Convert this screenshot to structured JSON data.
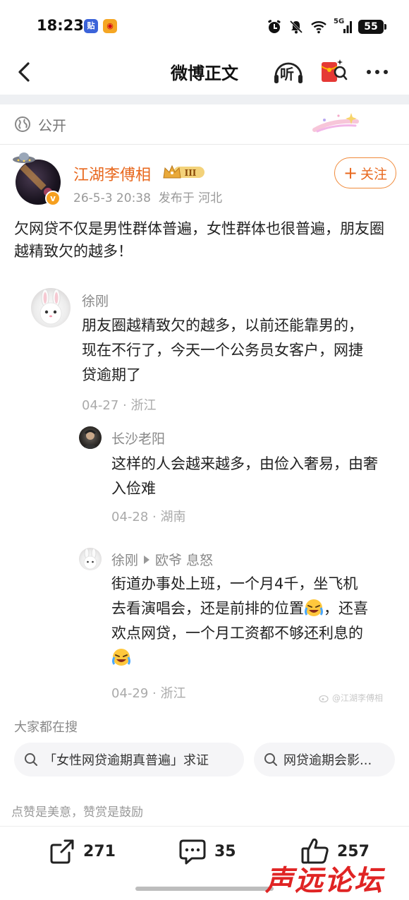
{
  "status_bar": {
    "time": "18:23",
    "app_icons": [
      "tieba-icon",
      "weibo-icon"
    ],
    "network": "5G",
    "battery": "55"
  },
  "nav": {
    "title": "微博正文",
    "listen_label": "听"
  },
  "visibility": {
    "label": "公开"
  },
  "author": {
    "name": "江湖李傅相",
    "badge_level": "III",
    "date": "26-5-3 20:38",
    "location": "发布于 河北",
    "verified_mark": "v",
    "follow_label": "关注"
  },
  "post": {
    "text": "欠网贷不仅是男性群体普遍，女性群体也很普遍，朋友圈越精致欠的越多！"
  },
  "comments": [
    {
      "user": "徐刚",
      "text": "朋友圈越精致欠的越多，以前还能靠男的，现在不行了，今天一个公务员女客户，网捷贷逾期了",
      "meta": "04-27 · 浙江",
      "replies": [
        {
          "user": "长沙老阳",
          "text": "这样的人会越来越多，由俭入奢易，由奢入俭难",
          "meta": "04-28 · 湖南"
        },
        {
          "user": "徐刚",
          "reply_to": "欧爷 息怒",
          "text_parts": [
            "街道办事处上班，一个月4千，坐飞机去看演唱会，还是前排的位置",
            "，还喜欢点网贷，一个月工资都不够还利息的"
          ],
          "meta": "04-29 · 浙江"
        }
      ]
    }
  ],
  "watermark": "@江湖李傅相",
  "search": {
    "title": "大家都在搜",
    "chips": [
      "「女性网贷逾期真普遍」求证",
      "网贷逾期会影..."
    ]
  },
  "encourage_text": "点赞是美意，赞赏是鼓励",
  "actions": {
    "share_count": "271",
    "comment_count": "35",
    "like_count": "257"
  },
  "forum_logo": "声远论坛",
  "colors": {
    "accent_orange": "#e8681e",
    "logo_red": "#e02424"
  }
}
